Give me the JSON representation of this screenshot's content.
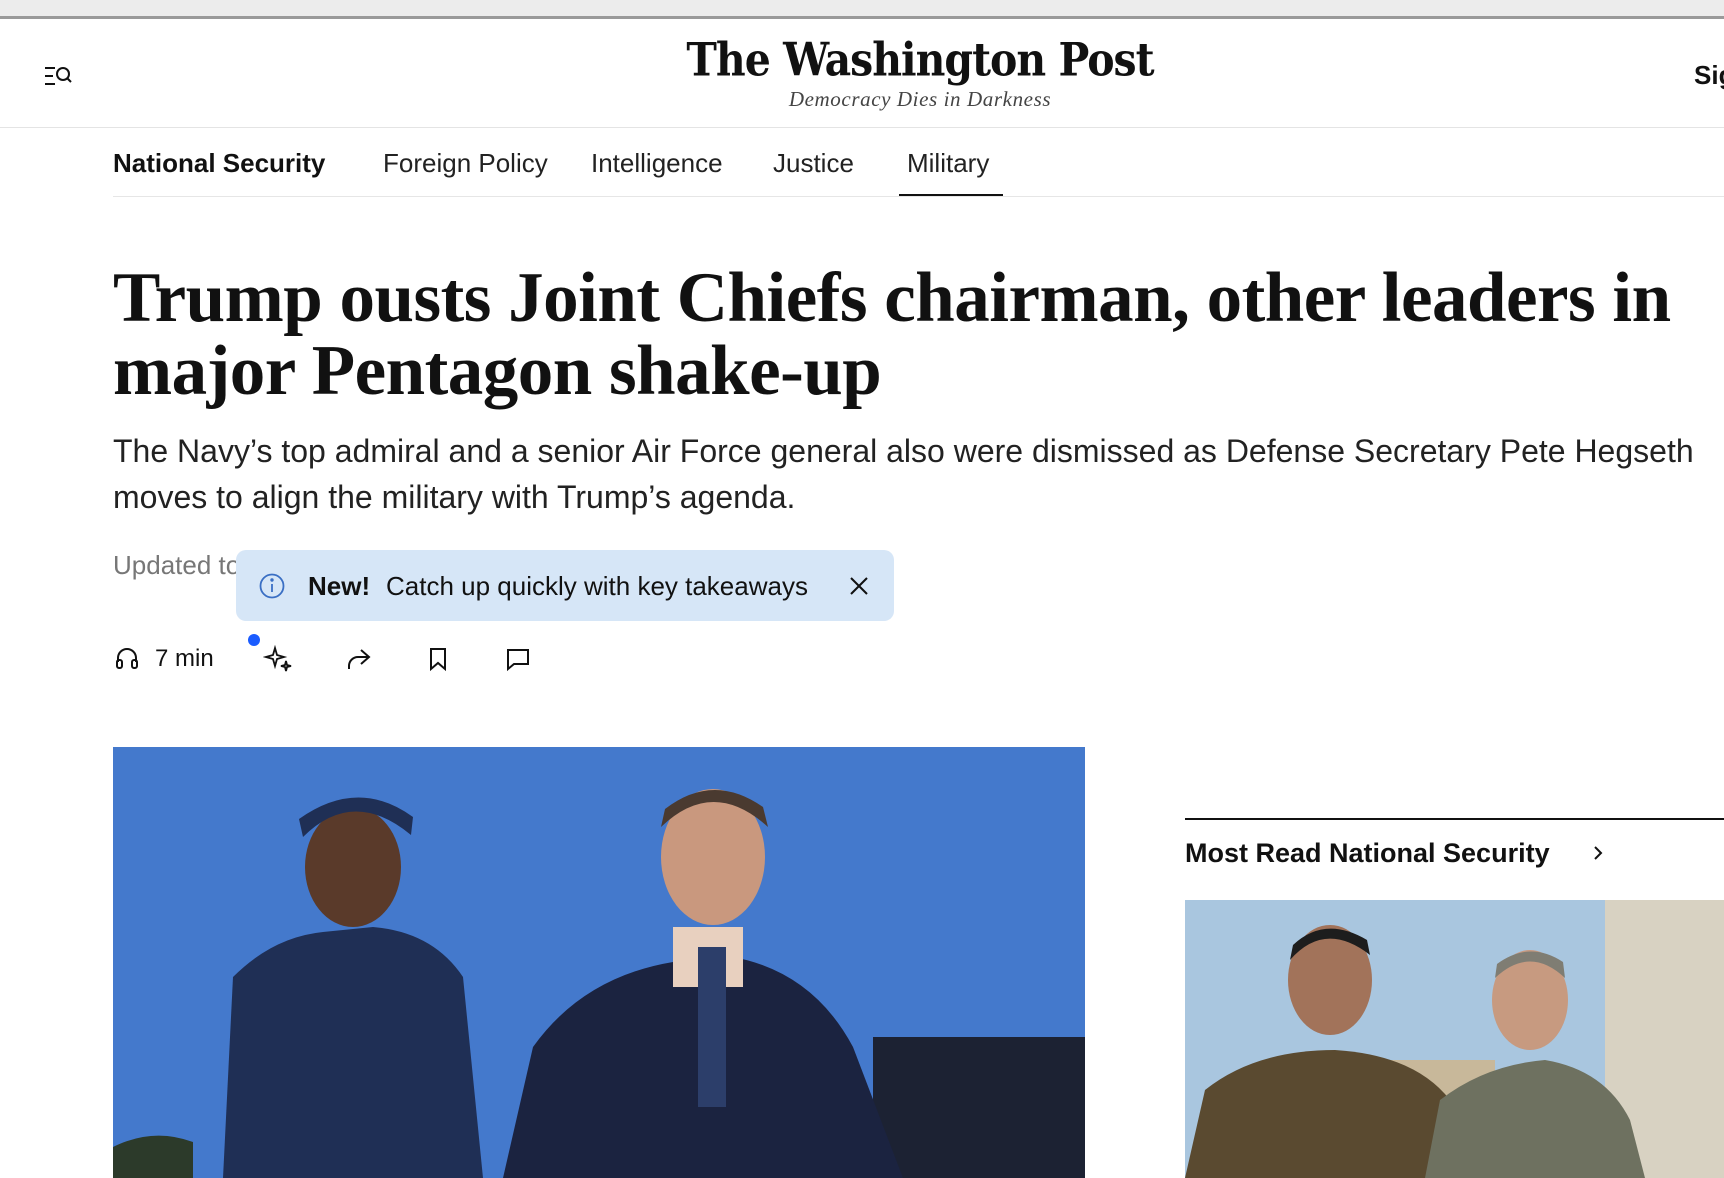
{
  "masthead": {
    "logo": "The Washington Post",
    "tagline": "Democracy Dies in Darkness",
    "sign_in": "Sign in"
  },
  "subnav": {
    "items": [
      {
        "label": "National Security",
        "active": true
      },
      {
        "label": "Foreign Policy",
        "active": false
      },
      {
        "label": "Intelligence",
        "active": false
      },
      {
        "label": "Justice",
        "active": false
      },
      {
        "label": "Military",
        "active": false
      }
    ]
  },
  "article": {
    "headline": "Trump ousts Joint Chiefs chairman, other leaders in major Pentagon shake-up",
    "dek": "The Navy’s top admiral and a senior Air Force general also were dismissed as Defense Secretary Pete Hegseth moves to align the military with Trump’s agenda.",
    "updated": "Updated to"
  },
  "toast": {
    "badge": "New!",
    "message": "Catch up quickly with key takeaways"
  },
  "actions": {
    "listen_duration": "7 min"
  },
  "rail": {
    "title": "Most Read National Security"
  },
  "icons": {
    "menu": "menu-search-icon",
    "info": "info-icon",
    "close": "close-icon",
    "listen": "headphones-icon",
    "summary": "sparkle-icon",
    "share": "share-icon",
    "save": "bookmark-icon",
    "comments": "comment-icon",
    "chevron": "chevron-right-icon"
  },
  "colors": {
    "toast_bg": "#d6e6f7",
    "dot": "#1a5cff",
    "text": "#111111"
  }
}
